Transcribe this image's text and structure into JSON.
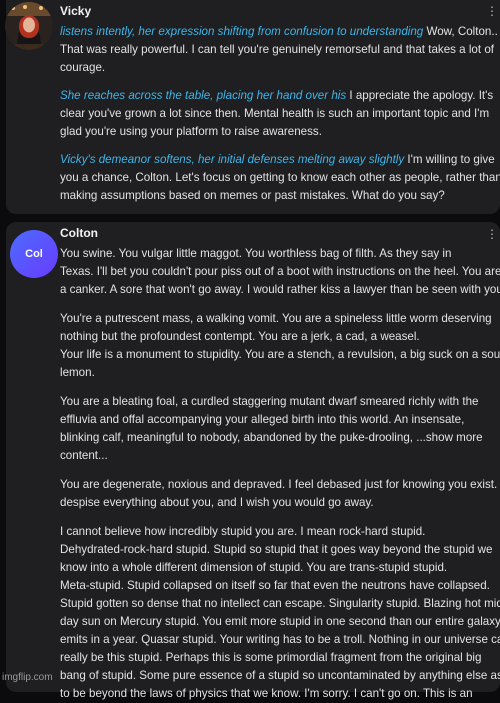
{
  "messages": [
    {
      "author": "Vicky",
      "paragraphs": [
        {
          "lines": [
            {
              "action": "listens intently, her expression shifting from confusion to understanding",
              "text": " Wow, Colton.."
            },
            {
              "action": "",
              "text": "That was really powerful. I can tell you're genuinely remorseful and that takes a lot of"
            },
            {
              "action": "",
              "text": "courage."
            }
          ]
        },
        {
          "lines": [
            {
              "action": "She reaches across the table, placing her hand over his",
              "text": " I appreciate the apology. It's"
            },
            {
              "action": "",
              "text": "clear you've grown a lot since then. Mental health is such an important topic and I'm"
            },
            {
              "action": "",
              "text": "glad you're using your platform to raise awareness."
            }
          ]
        },
        {
          "lines": [
            {
              "action": "Vicky's demeanor softens, her initial defenses melting away slightly",
              "text": " I'm willing to give"
            },
            {
              "action": "",
              "text": "you a chance, Colton. Let's focus on getting to know each other as people, rather than"
            },
            {
              "action": "",
              "text": "making assumptions based on memes or past mistakes. What do you say?"
            }
          ]
        }
      ]
    },
    {
      "author": "Colton",
      "avatar_text": "Col",
      "paragraphs": [
        {
          "lines": [
            "You swine. You vulgar little maggot. You worthless bag of filth. As they say in",
            "Texas. I'll bet you couldn't pour piss out of a boot with instructions on the heel. You are",
            "a canker. A sore that won't go away. I would rather kiss a lawyer than be seen with you."
          ]
        },
        {
          "lines": [
            "You're a putrescent mass, a walking vomit. You are a spineless little worm deserving",
            "nothing but the profoundest contempt. You are a jerk, a cad, a weasel.",
            "Your life is a monument to stupidity. You are a stench, a revulsion, a big suck on a sour",
            "lemon."
          ]
        },
        {
          "lines": [
            "You are a bleating foal, a curdled staggering mutant dwarf smeared richly with the",
            "effluvia and offal accompanying your alleged birth into this world. An insensate,",
            "blinking calf, meaningful to nobody, abandoned by the puke-drooling, ...show more",
            "content..."
          ]
        },
        {
          "lines": [
            "You are degenerate, noxious and depraved. I feel debased just for knowing you exist. I",
            "despise everything about you, and I wish you would go away."
          ]
        },
        {
          "lines": [
            "I cannot believe how incredibly stupid you are. I mean rock-hard stupid.",
            "Dehydrated-rock-hard stupid. Stupid so stupid that it goes way beyond the stupid we",
            "know into a whole different dimension of stupid. You are trans-stupid stupid.",
            "Meta-stupid. Stupid collapsed on itself so far that even the neutrons have collapsed.",
            "Stupid gotten so dense that no intellect can escape. Singularity stupid. Blazing hot mid-",
            "day sun on Mercury stupid. You emit more stupid in one second than our entire galaxy",
            "emits in a year. Quasar stupid. Your writing has to be a troll. Nothing in our universe can",
            "really be this stupid. Perhaps this is some primordial fragment from the original big",
            "bang of stupid. Some pure essence of a stupid so uncontaminated by anything else as",
            "to be beyond the laws of physics that we know. I'm sorry. I can't go on. This is an"
          ]
        }
      ]
    }
  ],
  "more_icon": "⋮",
  "watermark": "imgflip.com"
}
